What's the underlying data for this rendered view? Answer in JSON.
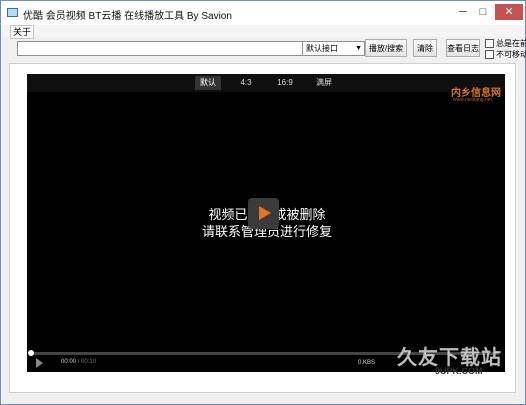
{
  "window": {
    "title": "优酷 会员视频 BT云播 在线播放工具 By Savion",
    "minimize": "─",
    "maximize": "□",
    "close": "✕"
  },
  "menu": {
    "about": "关于"
  },
  "toolbar": {
    "url_value": "",
    "interface_selected": "默认接口",
    "play_label": "播放/搜索",
    "clear_label": "清除",
    "log_label": "查看日志",
    "always_on_top": "总是在前",
    "no_move": "不可移动"
  },
  "player": {
    "ratios": [
      "默认",
      "4:3",
      "16:9",
      "满屏"
    ],
    "active_ratio": "默认",
    "brand_watermark": "内乡信息网",
    "brand_url": "www.neixiang.net",
    "message_line1": "视频已无法或被删除",
    "message_line2": "请联系管理员进行修复",
    "time_current": "00:00",
    "time_total": "/ 00:10",
    "speed": "0.KBS",
    "progress": 0
  },
  "watermark": {
    "big": "久友下载站",
    "url": "9UPK.COM"
  }
}
